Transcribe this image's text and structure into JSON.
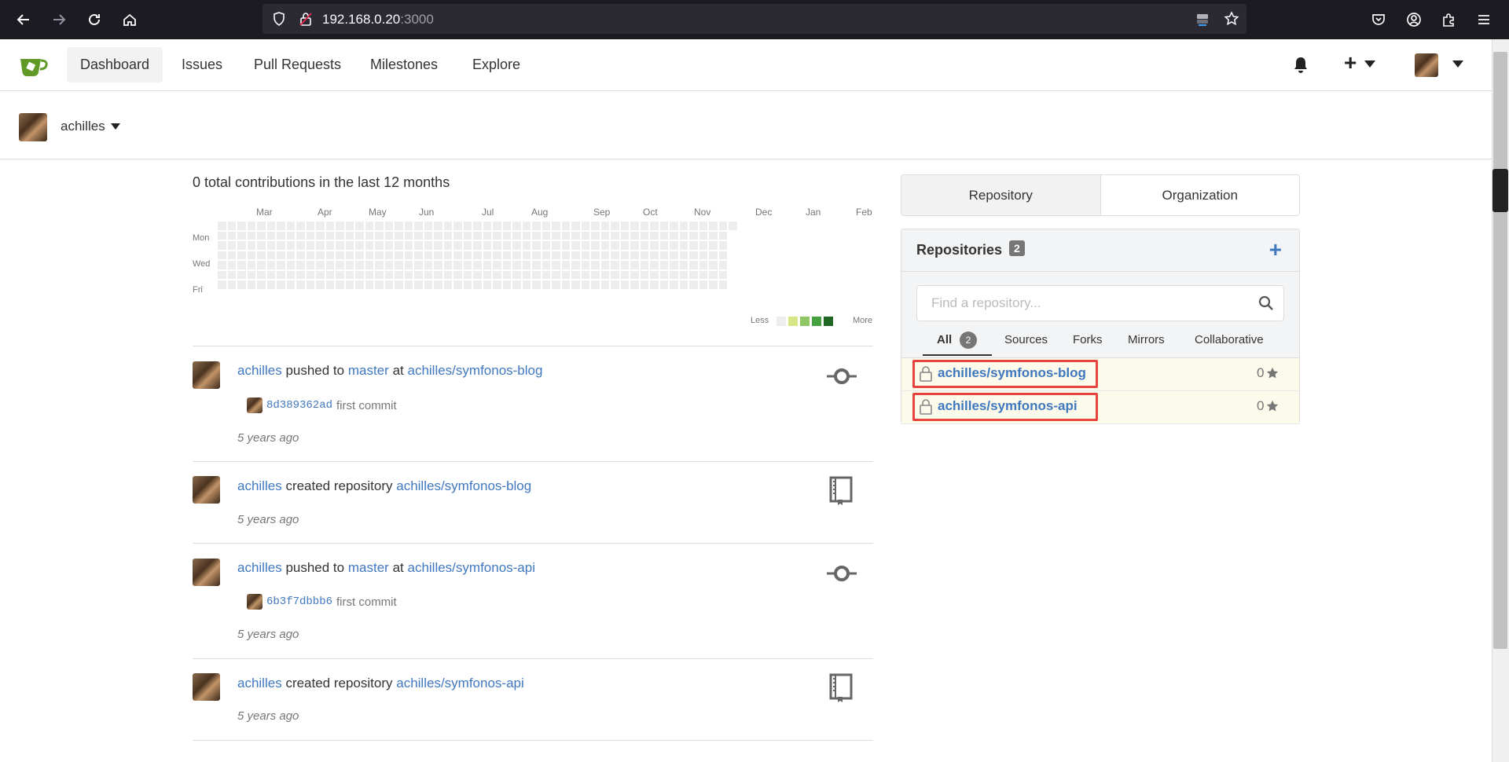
{
  "browser": {
    "url_host": "192.168.0.20",
    "url_port": ":3000"
  },
  "nav": {
    "items": [
      "Dashboard",
      "Issues",
      "Pull Requests",
      "Milestones",
      "Explore"
    ],
    "active": "Dashboard"
  },
  "context": {
    "username": "achilles"
  },
  "heatmap": {
    "title": "0 total contributions in the last 12 months",
    "months": [
      "Mar",
      "Apr",
      "May",
      "Jun",
      "Jul",
      "Aug",
      "Sep",
      "Oct",
      "Nov",
      "Dec",
      "Jan",
      "Feb"
    ],
    "days": [
      "Mon",
      "Wed",
      "Fri"
    ],
    "less_label": "Less",
    "more_label": "More",
    "legend_colors": [
      "#ededed",
      "#d6e685",
      "#8cc665",
      "#44a340",
      "#1e6823"
    ]
  },
  "feed": [
    {
      "user": "achilles",
      "action": "pushed to",
      "branch": "master",
      "at": "at",
      "repo": "achilles/symfonos-blog",
      "commit_sha": "8d389362ad",
      "commit_msg": "first commit",
      "ago": "5 years ago",
      "icon": "commit-icon"
    },
    {
      "user": "achilles",
      "action": "created repository",
      "repo": "achilles/symfonos-blog",
      "ago": "5 years ago",
      "icon": "repo-icon"
    },
    {
      "user": "achilles",
      "action": "pushed to",
      "branch": "master",
      "at": "at",
      "repo": "achilles/symfonos-api",
      "commit_sha": "6b3f7dbbb6",
      "commit_msg": "first commit",
      "ago": "5 years ago",
      "icon": "commit-icon"
    },
    {
      "user": "achilles",
      "action": "created repository",
      "repo": "achilles/symfonos-api",
      "ago": "5 years ago",
      "icon": "repo-icon"
    }
  ],
  "right": {
    "tabs": [
      "Repository",
      "Organization"
    ],
    "repos_title": "Repositories",
    "repos_count": "2",
    "search_placeholder": "Find a repository...",
    "filters": [
      "All",
      "Sources",
      "Forks",
      "Mirrors",
      "Collaborative"
    ],
    "all_count": "2",
    "repos": [
      {
        "name": "achilles/symfonos-blog",
        "stars": "0"
      },
      {
        "name": "achilles/symfonos-api",
        "stars": "0"
      }
    ]
  }
}
